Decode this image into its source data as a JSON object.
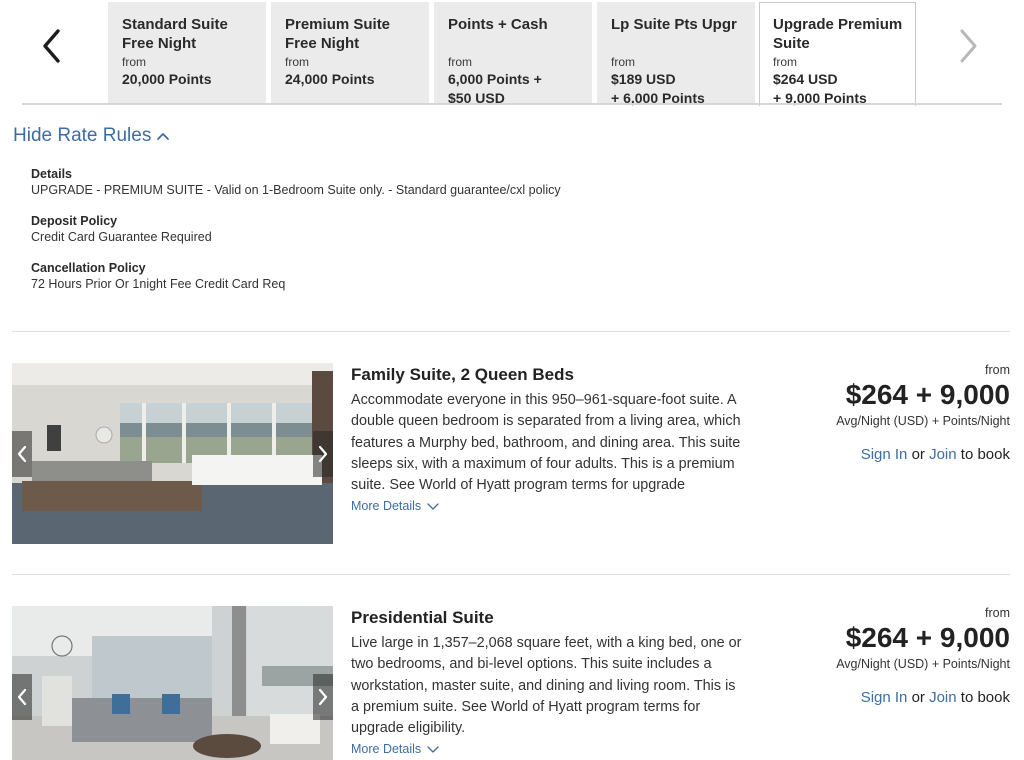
{
  "rate_tabs": [
    {
      "name_line1": "Standard Suite",
      "name_line2": "Free Night",
      "from": "from",
      "price_line1": "20,000 Points",
      "price_line2": "",
      "active": false
    },
    {
      "name_line1": "Premium Suite",
      "name_line2": "Free Night",
      "from": "from",
      "price_line1": "24,000 Points",
      "price_line2": "",
      "active": false
    },
    {
      "name_line1": "Points + Cash",
      "name_line2": "",
      "from": "from",
      "price_line1": "6,000 Points +",
      "price_line2": "$50 USD",
      "active": false
    },
    {
      "name_line1": "Lp Suite Pts Upgr",
      "name_line2": "",
      "from": "from",
      "price_line1": "$189 USD",
      "price_line2": "+ 6,000 Points",
      "active": false
    },
    {
      "name_line1": "Upgrade Premium",
      "name_line2": "Suite",
      "from": "from",
      "price_line1": "$264 USD",
      "price_line2": "+ 9,000 Points",
      "active": true
    }
  ],
  "rules": {
    "toggle_label": "Hide Rate Rules",
    "items": [
      {
        "title": "Details",
        "text": "UPGRADE - PREMIUM SUITE - Valid on 1-Bedroom Suite only. - Standard guarantee/cxl policy"
      },
      {
        "title": "Deposit Policy",
        "text": "Credit Card Guarantee Required"
      },
      {
        "title": "Cancellation Policy",
        "text": "72 Hours Prior Or 1night Fee Credit Card Req"
      }
    ]
  },
  "rooms": [
    {
      "title": "Family Suite, 2 Queen Beds",
      "description": "Accommodate everyone in this 950–961-square-foot suite. A double queen bedroom is separated from a living area, which features a Murphy bed, bathroom, and dining area. This suite sleeps six, with a maximum of four adults. This is a premium suite. See World of Hyatt program terms for upgrade eligibility.",
      "more_details": "More Details",
      "price_from": "from",
      "price": "$264 + 9,000",
      "price_unit": "Avg/Night (USD) + Points/Night",
      "sign_in": "Sign In",
      "or": "or",
      "join": "Join",
      "to_book": "to book"
    },
    {
      "title": "Presidential Suite",
      "description": "Live large in 1,357–2,068 square feet, with a king bed, one or two bedrooms, and bi-level options. This suite includes a workstation, master suite, and dining and living room. This is a premium suite. See World of Hyatt program terms for upgrade eligibility.",
      "more_details": "More Details",
      "price_from": "from",
      "price": "$264 + 9,000",
      "price_unit": "Avg/Night (USD) + Points/Night",
      "sign_in": "Sign In",
      "or": "or",
      "join": "Join",
      "to_book": "to book"
    }
  ],
  "colors": {
    "link": "#3d6da2",
    "tab_bg": "#ebebeb",
    "text": "#222222"
  },
  "icons": {
    "prev": "chevron-left-icon",
    "next": "chevron-right-icon",
    "toggle": "chevron-up-icon",
    "more": "chevron-down-icon"
  }
}
